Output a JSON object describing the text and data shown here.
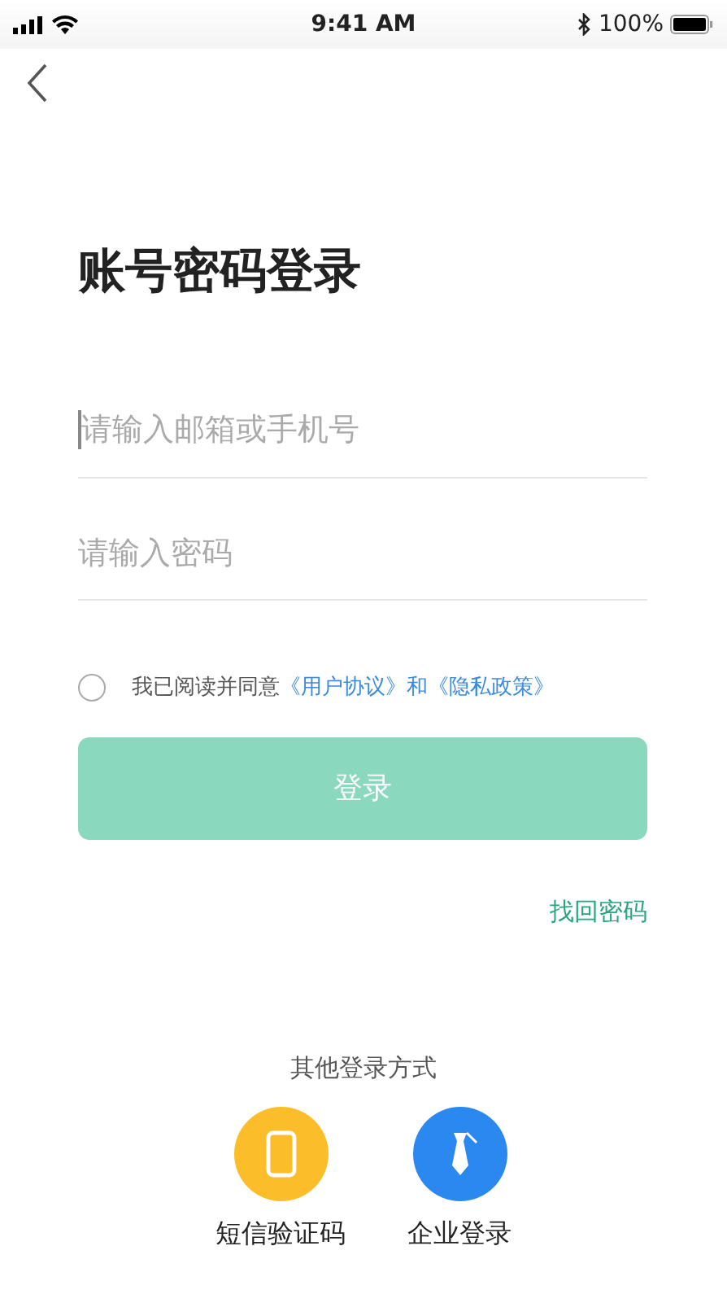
{
  "status_bar": {
    "time": "9:41 AM",
    "battery": "100%"
  },
  "title": "账号密码登录",
  "fields": [
    {
      "placeholder": "请输入邮箱或手机号",
      "focused": true
    },
    {
      "placeholder": "请输入密码",
      "focused": false
    }
  ],
  "agreement": {
    "checked": false,
    "prefix": "我已阅读并同意",
    "links": [
      "《用户协议》",
      "《隐私政策》"
    ],
    "joiner": "和"
  },
  "login_button": {
    "label": "登录",
    "disabled": true
  },
  "forgot_link": "找回密码",
  "other_title": "其他登录方式",
  "methods": [
    {
      "kind": "phone",
      "label": "短信验证码",
      "color": "#fbbd2a"
    },
    {
      "kind": "tie",
      "label": "企业登录",
      "color": "#2b88ee"
    }
  ]
}
